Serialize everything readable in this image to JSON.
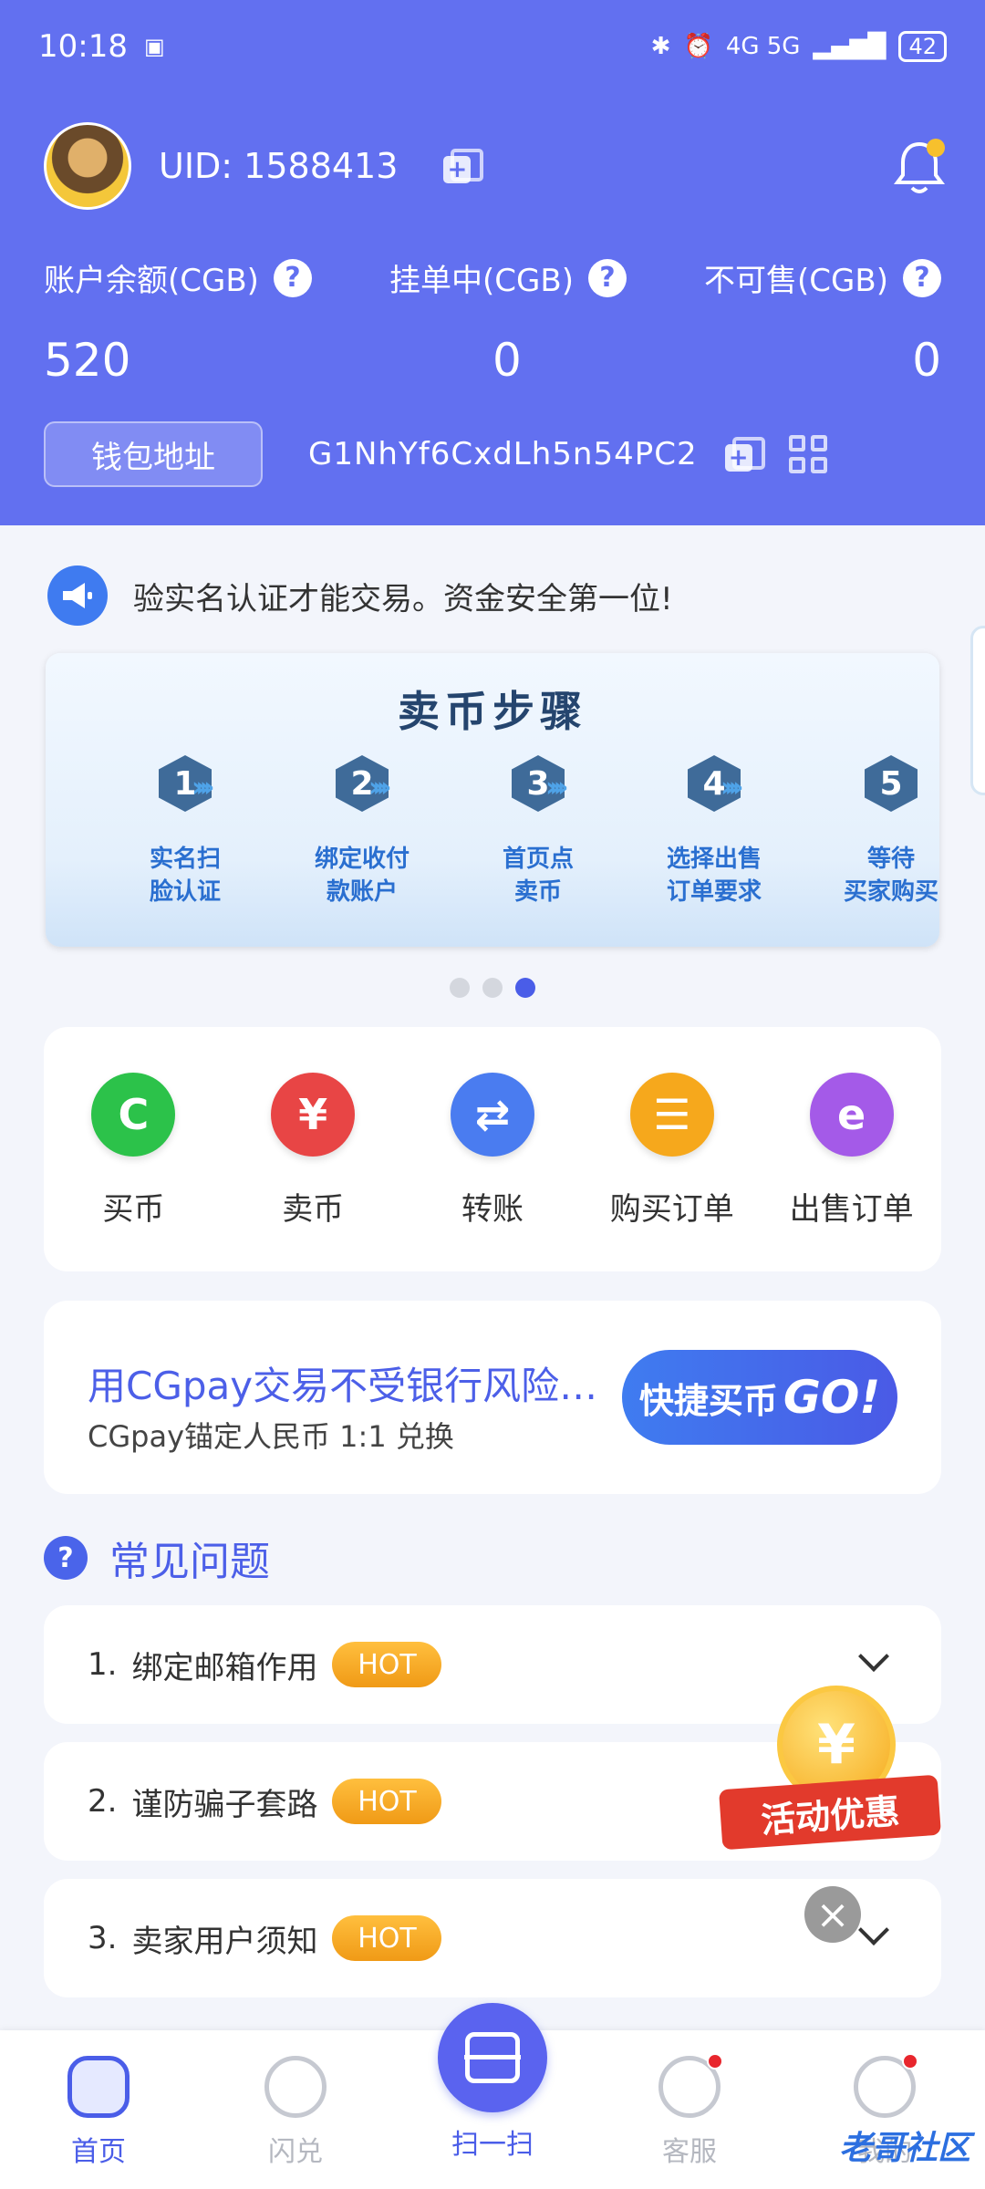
{
  "status_bar": {
    "time": "10:18",
    "indicators": "4G 5G",
    "battery": "42"
  },
  "profile": {
    "uid": "UID: 1588413"
  },
  "balances": {
    "labels": [
      "账户余额(CGB)",
      "挂单中(CGB)",
      "不可售(CGB)"
    ],
    "values": [
      "520",
      "0",
      "0"
    ]
  },
  "wallet": {
    "button": "钱包地址",
    "address": "G1NhYf6CxdLh5n54PC2"
  },
  "notice": {
    "text": "验实名认证才能交易。资金安全第一位!"
  },
  "banner": {
    "title": "卖币步骤",
    "steps": [
      {
        "num": "1",
        "label": "实名扫\n脸认证"
      },
      {
        "num": "2",
        "label": "绑定收付\n款账户"
      },
      {
        "num": "3",
        "label": "首页点\n卖币"
      },
      {
        "num": "4",
        "label": "选择出售\n订单要求"
      },
      {
        "num": "5",
        "label": "等待\n买家购买"
      }
    ],
    "active_page": 3,
    "pages": 3
  },
  "actions": [
    {
      "label": "买币",
      "icon": "buy-coin-icon",
      "color": "#2cc24a",
      "glyph": "C"
    },
    {
      "label": "卖币",
      "icon": "sell-coin-icon",
      "color": "#e84545",
      "glyph": "¥"
    },
    {
      "label": "转账",
      "icon": "transfer-icon",
      "color": "#4a7cf0",
      "glyph": "⇄"
    },
    {
      "label": "购买订单",
      "icon": "buy-order-icon",
      "color": "#f6a81c",
      "glyph": "☰"
    },
    {
      "label": "出售订单",
      "icon": "sell-order-icon",
      "color": "#a45ae8",
      "glyph": "e"
    }
  ],
  "promo": {
    "title": "用CGpay交易不受银行风险影响",
    "subtitle": "CGpay锚定人民币 1:1 兑换",
    "button": "快捷买币",
    "button_go": "GO!"
  },
  "faq": {
    "title": "常见问题",
    "hot_label": "HOT",
    "items": [
      {
        "num": "1.",
        "text": "绑定邮箱作用"
      },
      {
        "num": "2.",
        "text": "谨防骗子套路"
      },
      {
        "num": "3.",
        "text": "卖家用户须知"
      }
    ]
  },
  "floating_promo": {
    "glyph": "¥",
    "label": "活动优惠"
  },
  "tabbar": {
    "home": "首页",
    "flash": "闪兑",
    "scan": "扫一扫",
    "service": "客服",
    "mine": "我的"
  },
  "watermark": "老哥社区"
}
